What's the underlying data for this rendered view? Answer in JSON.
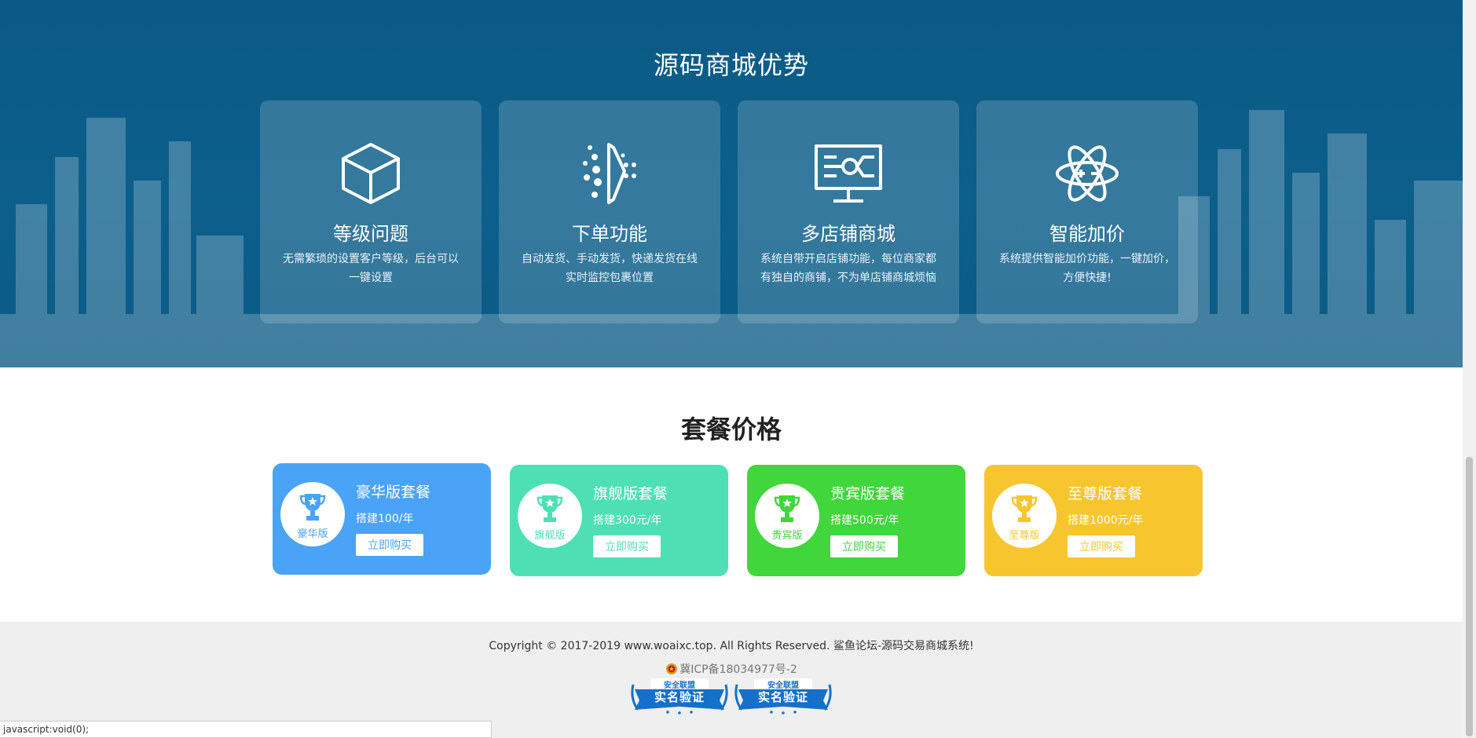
{
  "advantages": {
    "title": "源码商城优势",
    "cards": [
      {
        "icon": "cube-icon",
        "title": "等级问题",
        "desc": "无需繁琐的设置客户等级，后台可以一键设置"
      },
      {
        "icon": "dots-gate-icon",
        "title": "下单功能",
        "desc": "自动发货、手动发货，快递发货在线实时监控包裹位置"
      },
      {
        "icon": "monitor-circuit-icon",
        "title": "多店铺商城",
        "desc": "系统自带开启店铺功能，每位商家都有独自的商铺，不为单店铺商城烦恼"
      },
      {
        "icon": "atom-icon",
        "title": "智能加价",
        "desc": "系统提供智能加价功能，一键加价，方便快捷!"
      }
    ]
  },
  "pricing": {
    "title": "套餐价格",
    "plans": [
      {
        "name": "豪华版套餐",
        "price": "搭建100/年",
        "badge": "豪华版",
        "button": "立即购买",
        "color": "#4aa3f7"
      },
      {
        "name": "旗舰版套餐",
        "price": "搭建300元/年",
        "badge": "旗舰版",
        "button": "立即购买",
        "color": "#4ee0b4"
      },
      {
        "name": "贵宾版套餐",
        "price": "搭建500元/年",
        "badge": "贵宾版",
        "button": "立即购买",
        "color": "#41d63b"
      },
      {
        "name": "至尊版套餐",
        "price": "搭建1000元/年",
        "badge": "至尊版",
        "button": "立即购买",
        "color": "#f7c52e"
      }
    ]
  },
  "footer": {
    "copyright": "Copyright © 2017-2019 www.woaixc.top. All Rights Reserved. 鲨鱼论坛-源码交易商城系统!",
    "icp": "冀ICP备18034977号-2",
    "badges": [
      {
        "top": "安全联盟",
        "main": "实名验证"
      },
      {
        "top": "安全联盟",
        "main": "实名验证"
      }
    ]
  },
  "statusbar": {
    "text": "javascript:void(0);"
  },
  "colors": {
    "hero_bg": "#0b5a86",
    "footer_bg": "#efefef"
  }
}
